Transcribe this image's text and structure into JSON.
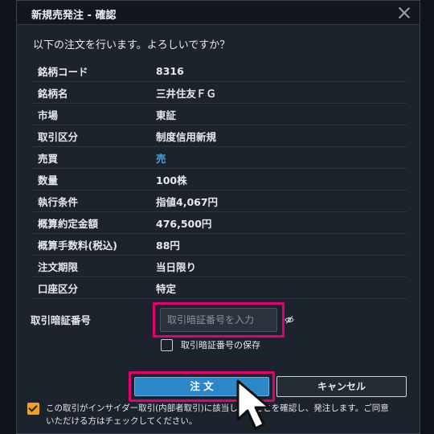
{
  "dialog": {
    "title": "新規売発注 - 確認",
    "prompt": "以下の注文を行います。よろしいですか？"
  },
  "order": {
    "rows": [
      {
        "label": "銘柄コード",
        "value": "8316"
      },
      {
        "label": "銘柄名",
        "value": "三井住友ＦＧ"
      },
      {
        "label": "市場",
        "value": "東証"
      },
      {
        "label": "取引区分",
        "value": "制度信用新規"
      },
      {
        "label": "売買",
        "value": "売"
      },
      {
        "label": "数量",
        "value": "100株"
      },
      {
        "label": "執行条件",
        "value": "指値4,067円"
      },
      {
        "label": "概算約定金額",
        "value": "476,500円"
      },
      {
        "label": "概算手数料(税込)",
        "value": "88円"
      },
      {
        "label": "注文期限",
        "value": "当日限り"
      },
      {
        "label": "口座区分",
        "value": "特定"
      }
    ]
  },
  "pin": {
    "label": "取引暗証番号",
    "placeholder": "取引暗証番号を入力",
    "value": "",
    "save_label": "取引暗証番号の保存",
    "save_checked": false
  },
  "buttons": {
    "order_label": "注 文",
    "cancel_label": "キャンセル"
  },
  "confirm": {
    "checked": true,
    "text": "この取引がインサイダー取引(内部者取引)に該当しないことを確認し、発注します。ご同意いただける方はチェックしてください。"
  },
  "icons": {
    "close": "close-icon",
    "eye": "eye-slash-icon",
    "cursor": "mouse-pointer-icon"
  },
  "colors": {
    "highlight": "#e4006e",
    "primary_button": "#2c87c9",
    "sell": "#4aa0e8",
    "checkbox_checked": "#f0a023",
    "dialog_bg": "#1c232c"
  }
}
